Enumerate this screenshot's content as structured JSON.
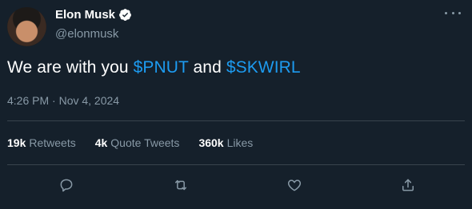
{
  "author": {
    "display_name": "Elon Musk",
    "handle": "@elonmusk",
    "verified_icon": "verified-badge-icon"
  },
  "tweet": {
    "text_parts": [
      "We are with you ",
      "$PNUT",
      " and ",
      "$SKWIRL"
    ],
    "timestamp": "4:26 PM · Nov 4, 2024"
  },
  "stats": {
    "retweets_count": "19k",
    "retweets_label": "Retweets",
    "quotes_count": "4k",
    "quotes_label": "Quote Tweets",
    "likes_count": "360k",
    "likes_label": "Likes"
  },
  "actions": [
    "reply-icon",
    "retweet-icon",
    "like-icon",
    "share-icon"
  ],
  "colors": {
    "background": "#15202b",
    "accent": "#1d9bf0",
    "secondary_text": "#8899a6",
    "divider": "#38444d"
  }
}
